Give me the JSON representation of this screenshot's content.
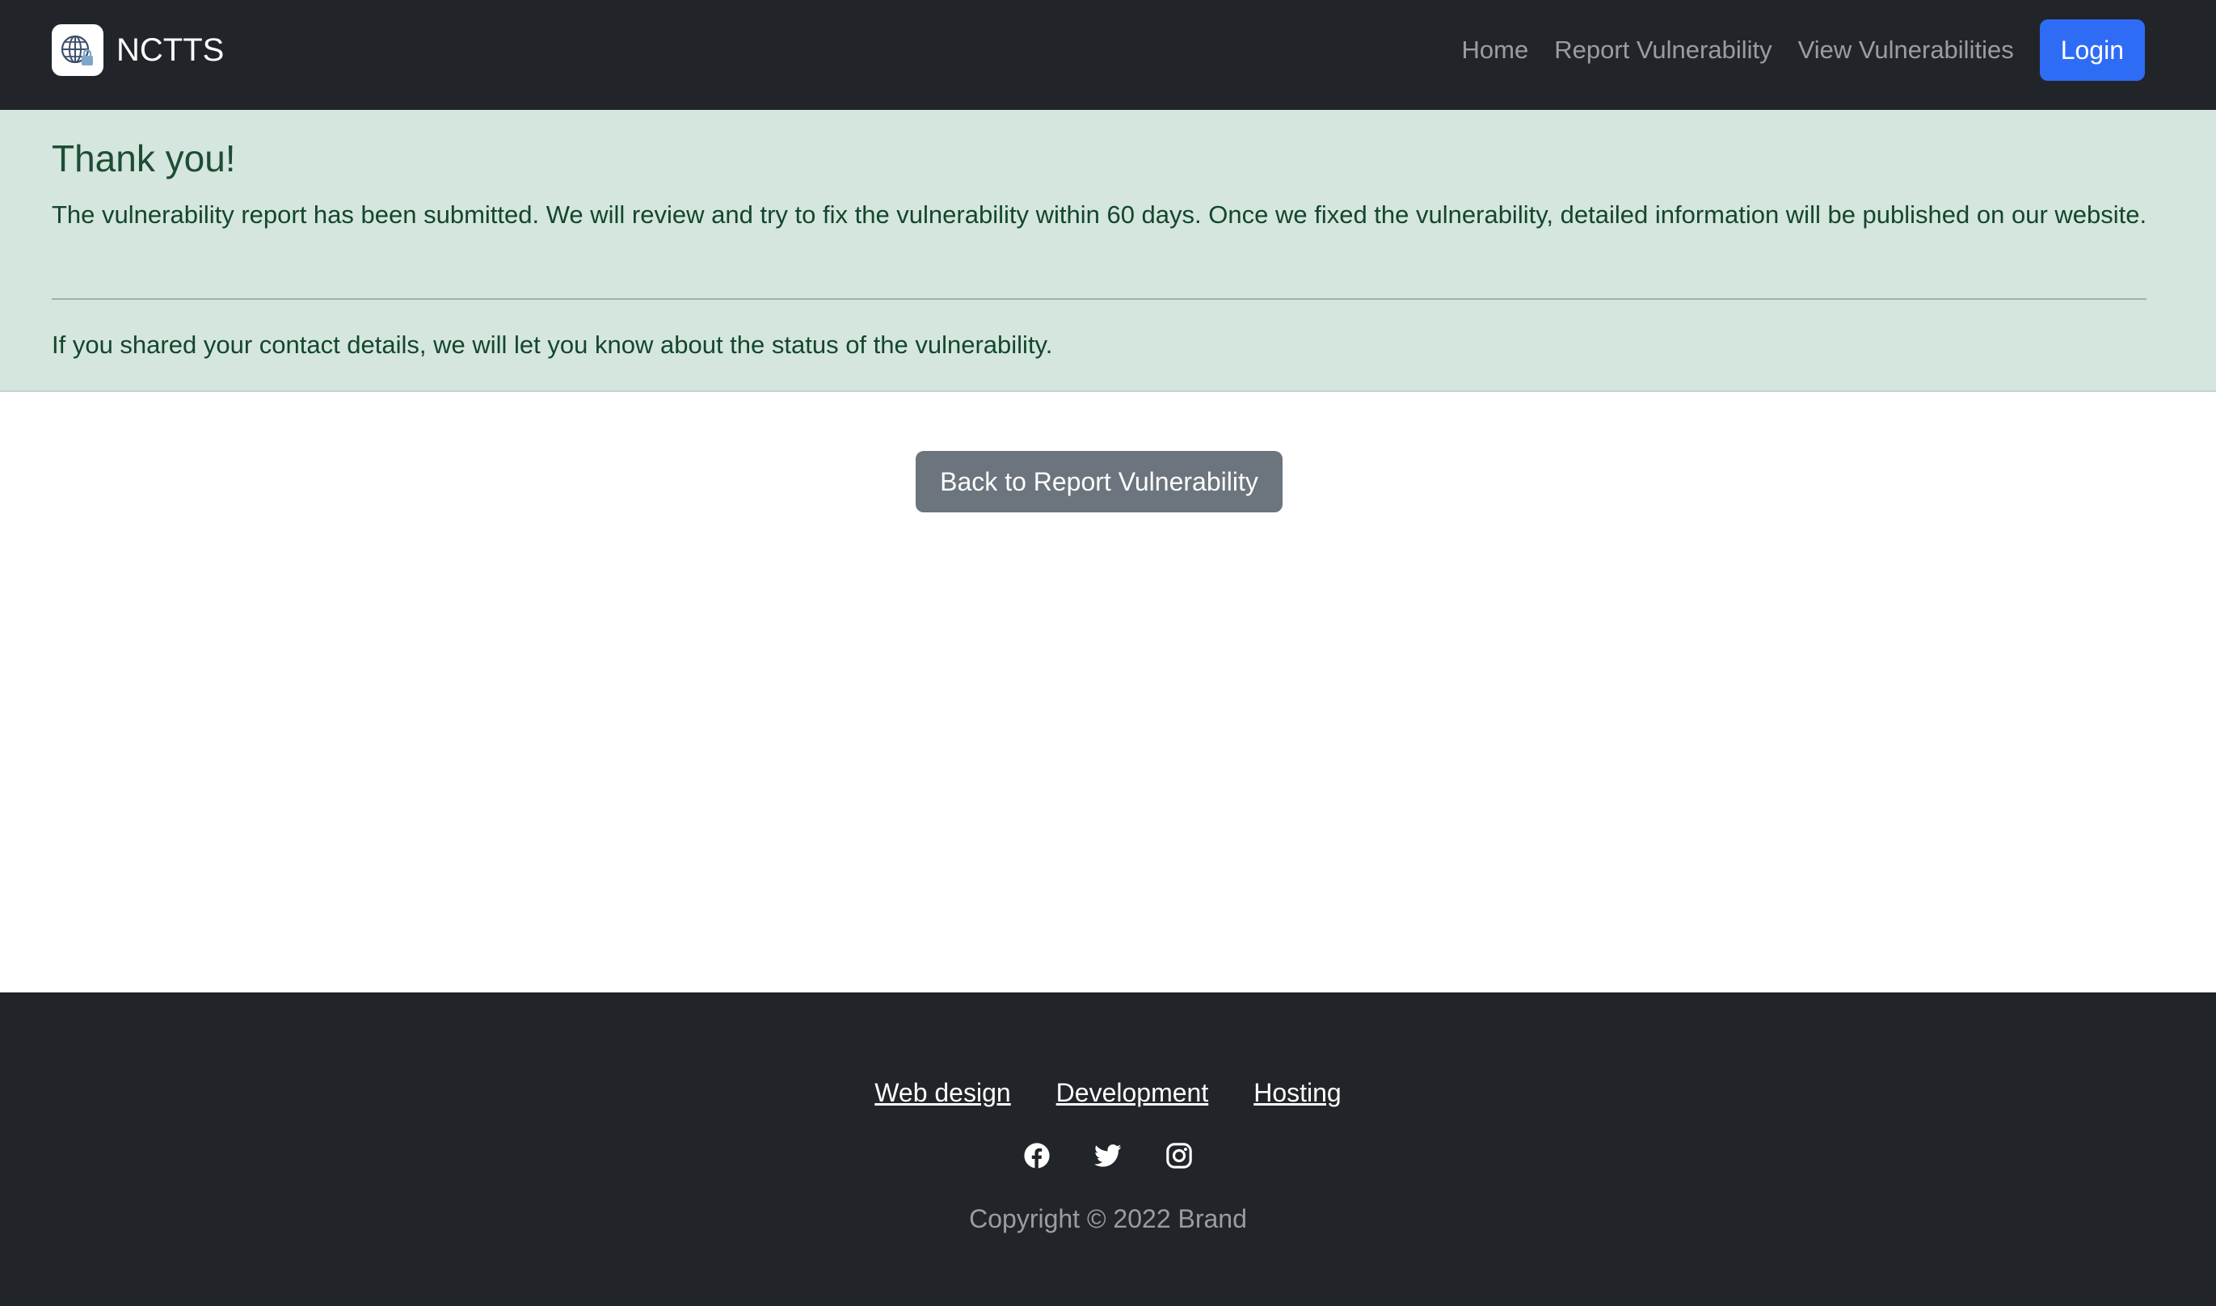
{
  "navbar": {
    "brand": "NCTTS",
    "links": [
      "Home",
      "Report Vulnerability",
      "View Vulnerabilities"
    ],
    "login_label": "Login"
  },
  "alert": {
    "heading": "Thank you!",
    "text": "The vulnerability report has been submitted. We will review and try to fix the vulnerability within 60 days. Once we fixed the vulnerability, detailed information will be published on our website.",
    "text2": "If you shared your contact details, we will let you know about the status of the vulnerability."
  },
  "main": {
    "back_button_label": "Back to Report Vulnerability"
  },
  "footer": {
    "links": [
      "Web design",
      "Development",
      "Hosting"
    ],
    "social_icons": [
      "facebook-icon",
      "twitter-icon",
      "instagram-icon"
    ],
    "copyright": "Copyright © 2022 Brand"
  },
  "colors": {
    "navbar_bg": "#212529",
    "primary": "#2f6cf6",
    "alert_bg": "#d4e6dd",
    "alert_text": "#14462d",
    "secondary": "#6c757d"
  }
}
